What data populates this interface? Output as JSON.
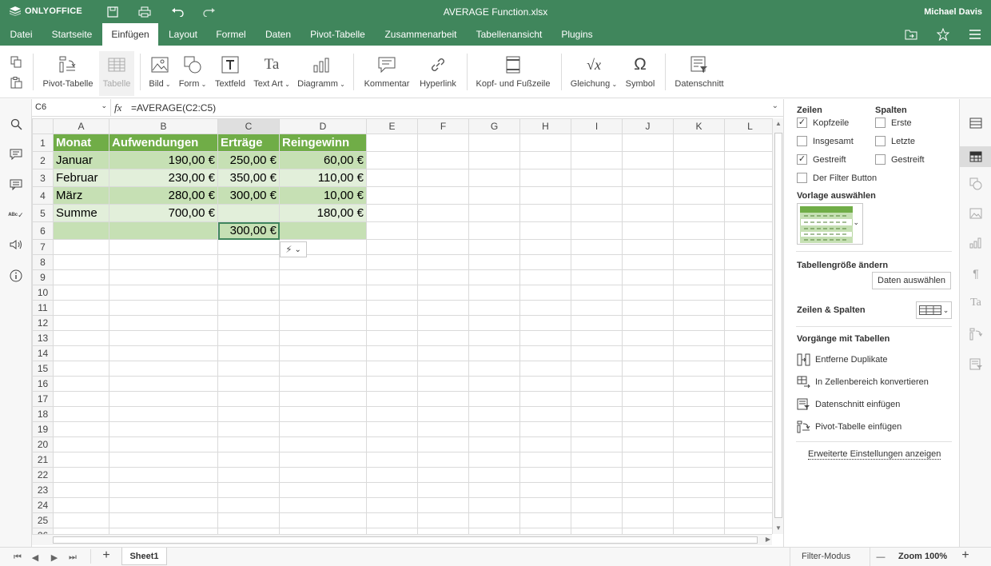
{
  "titlebar": {
    "brand": "ONLYOFFICE",
    "doc_title": "AVERAGE Function.xlsx",
    "user": "Michael Davis"
  },
  "menu": {
    "tabs": [
      "Datei",
      "Startseite",
      "Einfügen",
      "Layout",
      "Formel",
      "Daten",
      "Pivot-Tabelle",
      "Zusammenarbeit",
      "Tabellenansicht",
      "Plugins"
    ],
    "active": "Einfügen"
  },
  "toolbar": {
    "pivot": "Pivot-Tabelle",
    "table": "Tabelle",
    "image": "Bild",
    "shape": "Form",
    "textbox": "Textfeld",
    "textart": "Text Art",
    "chart": "Diagramm",
    "comment": "Kommentar",
    "hyperlink": "Hyperlink",
    "headerfooter": "Kopf- und Fußzeile",
    "equation": "Gleichung",
    "symbol": "Symbol",
    "slicer": "Datenschnitt"
  },
  "formula_bar": {
    "cell_ref": "C6",
    "fx": "fx",
    "formula": "=AVERAGE(C2:C5)"
  },
  "grid": {
    "columns": [
      "A",
      "B",
      "C",
      "D",
      "E",
      "F",
      "G",
      "H",
      "I",
      "J",
      "K",
      "L"
    ],
    "row_numbers": [
      "1",
      "2",
      "3",
      "4",
      "5",
      "6",
      "7",
      "8",
      "9",
      "10",
      "11",
      "12",
      "13",
      "14",
      "15",
      "16",
      "17",
      "18",
      "19",
      "20",
      "21",
      "22",
      "23",
      "24",
      "25",
      "26"
    ],
    "header": [
      "Monat",
      "Aufwendungen",
      "Erträge",
      "Reingewinn"
    ],
    "rows": [
      [
        "Januar",
        "190,00 €",
        "250,00 €",
        "60,00 €"
      ],
      [
        "Februar",
        "230,00 €",
        "350,00 €",
        "110,00 €"
      ],
      [
        "März",
        "280,00 €",
        "300,00 €",
        "10,00 €"
      ],
      [
        "Summe",
        "700,00 €",
        "",
        "180,00 €"
      ],
      [
        "",
        "",
        "300,00 €",
        ""
      ]
    ],
    "colors": {
      "header": "#70ad47",
      "band": "#c6e0b4",
      "light": "#e2efda"
    }
  },
  "panel": {
    "rows_title": "Zeilen",
    "cols_title": "Spalten",
    "row_options": [
      {
        "label": "Kopfzeile",
        "checked": true
      },
      {
        "label": "Insgesamt",
        "checked": false
      },
      {
        "label": "Gestreift",
        "checked": true
      }
    ],
    "col_options": [
      {
        "label": "Erste",
        "checked": false
      },
      {
        "label": "Letzte",
        "checked": false
      },
      {
        "label": "Gestreift",
        "checked": false
      }
    ],
    "filter_button": "Der Filter Button",
    "template_title": "Vorlage auswählen",
    "resize_title": "Tabellengröße ändern",
    "select_data": "Daten auswählen",
    "rows_cols": "Zeilen & Spalten",
    "ops_title": "Vorgänge mit Tabellen",
    "ops": [
      "Entferne Duplikate",
      "In Zellenbereich konvertieren",
      "Datenschnitt einfügen",
      "Pivot-Tabelle einfügen"
    ],
    "advanced": "Erweiterte Einstellungen anzeigen"
  },
  "status": {
    "sheet": "Sheet1",
    "filter_mode": "Filter-Modus",
    "zoom": "Zoom 100%",
    "minus": "—",
    "plus": "+",
    "add": "+"
  },
  "accent": "#40865c"
}
